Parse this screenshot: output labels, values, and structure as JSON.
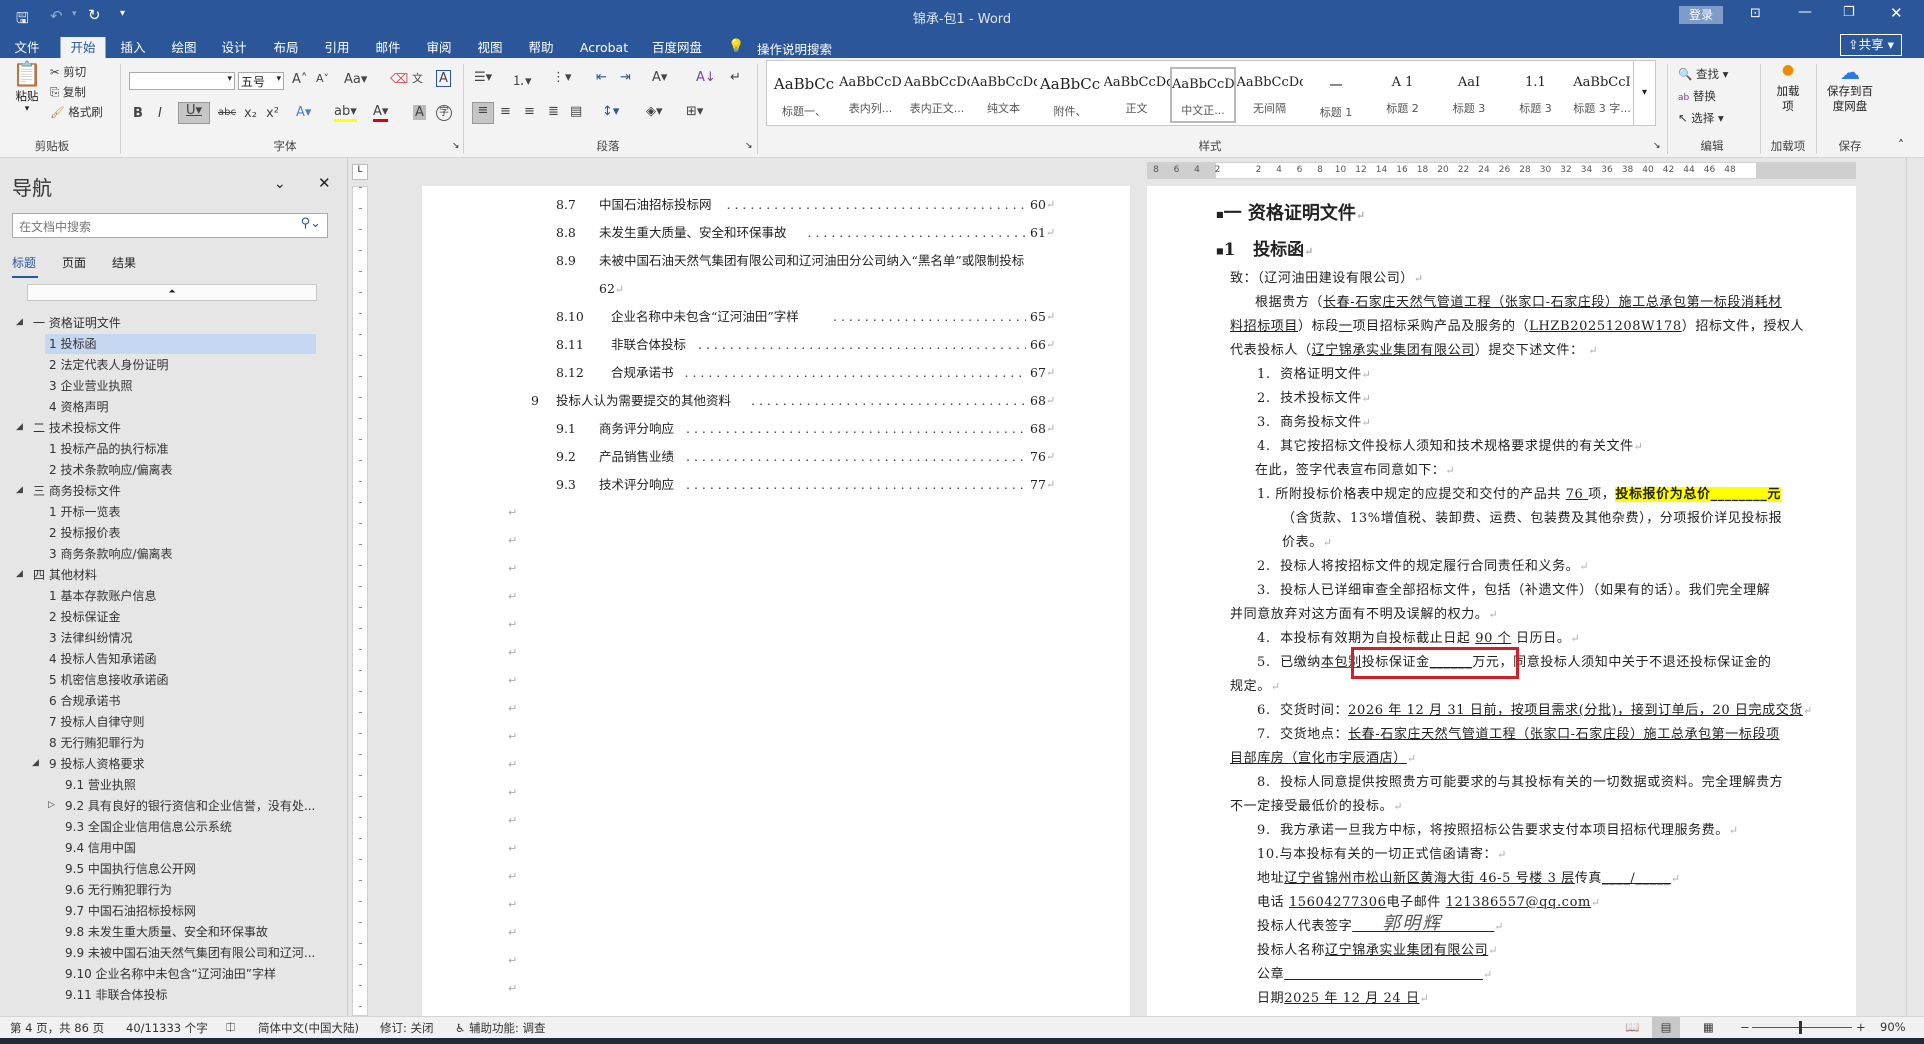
{
  "window": {
    "title": "锦承-包1 - Word",
    "login": "登录"
  },
  "qat": {
    "save": "save-icon",
    "undo": "undo-icon",
    "redo": "redo-icon",
    "customize": "▾"
  },
  "tabs": [
    "文件",
    "开始",
    "插入",
    "绘图",
    "设计",
    "布局",
    "引用",
    "邮件",
    "审阅",
    "视图",
    "帮助",
    "Acrobat",
    "百度网盘"
  ],
  "active_tab": "开始",
  "tell_me": "操作说明搜索",
  "share": "共享",
  "ribbon": {
    "clipboard": {
      "paste": "粘贴",
      "cut": "剪切",
      "copy": "复制",
      "format_painter": "格式刷",
      "label": "剪贴板"
    },
    "font": {
      "font_name": "",
      "font_size": "五号",
      "label": "字体"
    },
    "paragraph": {
      "label": "段落"
    },
    "styles": {
      "label": "样式",
      "items": [
        {
          "preview": "AaBbCc",
          "name": "标题一、"
        },
        {
          "preview": "AaBbCcD",
          "name": "表内列..."
        },
        {
          "preview": "AaBbCcDdI",
          "name": "表内正文..."
        },
        {
          "preview": "AaBbCcDdI",
          "name": "纯文本"
        },
        {
          "preview": "AaBbCc",
          "name": "附件、"
        },
        {
          "preview": "AaBbCcDdI",
          "name": "正文"
        },
        {
          "preview": "AaBbCcDc",
          "name": "中文正..."
        },
        {
          "preview": "AaBbCcDdI",
          "name": "无间隔"
        },
        {
          "preview": "一",
          "name": "标题 1"
        },
        {
          "preview": "A 1",
          "name": "标题 2"
        },
        {
          "preview": "AaI",
          "name": "标题 3"
        },
        {
          "preview": "1.1",
          "name": "标题 3"
        },
        {
          "preview": "AaBbCcI",
          "name": "标题 3 字..."
        }
      ],
      "selected": "中文正..."
    },
    "editing": {
      "find": "查找",
      "replace": "替换",
      "select": "选择",
      "label": "编辑"
    },
    "addins": {
      "button": "加载项",
      "label": "加载项"
    },
    "save_group": {
      "button": "保存到百度网盘",
      "label": "保存"
    }
  },
  "nav": {
    "title": "导航",
    "search_placeholder": "在文档中搜索",
    "tabs": [
      "标题",
      "页面",
      "结果"
    ],
    "active_tab": "标题",
    "items": [
      {
        "level": 1,
        "text": "一 资格证明文件",
        "state": "expanded"
      },
      {
        "level": 2,
        "text": "1 投标函",
        "selected": true
      },
      {
        "level": 2,
        "text": "2 法定代表人身份证明"
      },
      {
        "level": 2,
        "text": "3 企业营业执照"
      },
      {
        "level": 2,
        "text": "4 资格声明"
      },
      {
        "level": 1,
        "text": "二 技术投标文件",
        "state": "expanded"
      },
      {
        "level": 2,
        "text": "1 投标产品的执行标准"
      },
      {
        "level": 2,
        "text": "2 技术条款响应/偏离表"
      },
      {
        "level": 1,
        "text": "三 商务投标文件",
        "state": "expanded"
      },
      {
        "level": 2,
        "text": "1 开标一览表"
      },
      {
        "level": 2,
        "text": "2 投标报价表"
      },
      {
        "level": 2,
        "text": "3 商务条款响应/偏离表"
      },
      {
        "level": 1,
        "text": "四 其他材料",
        "state": "expanded"
      },
      {
        "level": 2,
        "text": "1 基本存款账户信息"
      },
      {
        "level": 2,
        "text": "2 投标保证金"
      },
      {
        "level": 2,
        "text": "3 法律纠纷情况"
      },
      {
        "level": 2,
        "text": "4 投标人告知承诺函"
      },
      {
        "level": 2,
        "text": "5 机密信息接收承诺函"
      },
      {
        "level": 2,
        "text": "6 合规承诺书"
      },
      {
        "level": 2,
        "text": "7 投标人自律守则"
      },
      {
        "level": 2,
        "text": "8 无行贿犯罪行为"
      },
      {
        "level": 2,
        "text": "9 投标人资格要求",
        "state": "expanded"
      },
      {
        "level": 3,
        "text": "9.1 营业执照"
      },
      {
        "level": 3,
        "text": "9.2 具有良好的银行资信和企业信誉，没有处...",
        "state": "collapsed"
      },
      {
        "level": 3,
        "text": "9.3 全国企业信用信息公示系统"
      },
      {
        "level": 3,
        "text": "9.4 信用中国"
      },
      {
        "level": 3,
        "text": "9.5 中国执行信息公开网"
      },
      {
        "level": 3,
        "text": "9.6 无行贿犯罪行为"
      },
      {
        "level": 3,
        "text": "9.7 中国石油招标投标网"
      },
      {
        "level": 3,
        "text": "9.8 未发生重大质量、安全和环保事故"
      },
      {
        "level": 3,
        "text": "9.9 未被中国石油天然气集团有限公司和辽河..."
      },
      {
        "level": 3,
        "text": "9.10 企业名称中未包含“辽河油田”字样"
      },
      {
        "level": 3,
        "text": "9.11 非联合体投标"
      }
    ]
  },
  "ruler": [
    "8",
    "6",
    "4",
    "2",
    "",
    "2",
    "4",
    "6",
    "8",
    "10",
    "12",
    "14",
    "16",
    "18",
    "20",
    "22",
    "24",
    "26",
    "28",
    "30",
    "32",
    "34",
    "36",
    "38",
    "40",
    "42",
    "44",
    "46",
    "48"
  ],
  "toc": [
    {
      "num": "8.7",
      "title": "中国石油招标投标网",
      "page": "60",
      "level": 2
    },
    {
      "num": "8.8",
      "title": "未发生重大质量、安全和环保事故",
      "page": "61",
      "level": 2
    },
    {
      "num": "8.9",
      "title": "未被中国石油天然气集团有限公司和辽河油田分公司纳入“黑名单”或限制投标",
      "page": "62",
      "level": 2,
      "wrapped": true
    },
    {
      "num": "8.10",
      "title": "企业名称中未包含“辽河油田”字样",
      "page": "65",
      "level": 3
    },
    {
      "num": "8.11",
      "title": "非联合体投标",
      "page": "66",
      "level": 3
    },
    {
      "num": "8.12",
      "title": "合规承诺书",
      "page": "67",
      "level": 3
    },
    {
      "num": "9",
      "title": "投标人认为需要提交的其他资料",
      "page": "68",
      "level": 1
    },
    {
      "num": "9.1",
      "title": "商务评分响应",
      "page": "68",
      "level": 2
    },
    {
      "num": "9.2",
      "title": "产品销售业绩",
      "page": "76",
      "level": 2
    },
    {
      "num": "9.3",
      "title": "技术评分响应",
      "page": "77",
      "level": 2
    }
  ],
  "doc": {
    "heading1": "一 资格证明文件",
    "heading2_num": "1",
    "heading2": "投标函",
    "signature": "郭明辉",
    "lines": [
      {
        "kind": "flush",
        "segs": [
          {
            "t": "致：（辽河油田建设有限公司）"
          }
        ]
      },
      {
        "kind": "first",
        "segs": [
          {
            "t": "根据贵方（"
          },
          {
            "t": "长春-石家庄天然气管道工程（张家口-石家庄段）施工总承包第一标段消耗材",
            "s": "u"
          }
        ],
        "nopm": true
      },
      {
        "kind": "flush",
        "segs": [
          {
            "t": "料招标项目",
            "s": "u"
          },
          {
            "t": "）标段"
          },
          {
            "t": "一",
            "s": "u"
          },
          {
            "t": "项目招标采购产品及服务的（"
          },
          {
            "t": "LHZB20251208W178",
            "s": "u"
          },
          {
            "t": "）招标文件，授权人"
          }
        ],
        "nopm": true
      },
      {
        "kind": "flush",
        "segs": [
          {
            "t": "代表投标人（"
          },
          {
            "t": "辽宁锦承实业集团有限公司",
            "s": "u"
          },
          {
            "t": "）提交下述文件： "
          }
        ]
      },
      {
        "kind": "list",
        "segs": [
          {
            "t": "1.  资格证明文件"
          }
        ]
      },
      {
        "kind": "list",
        "segs": [
          {
            "t": "2.  技术投标文件"
          }
        ]
      },
      {
        "kind": "list",
        "segs": [
          {
            "t": "3.  商务投标文件"
          }
        ]
      },
      {
        "kind": "list",
        "segs": [
          {
            "t": "4.  其它按招标文件投标人须知和技术规格要求提供的有关文件"
          }
        ]
      },
      {
        "kind": "first",
        "segs": [
          {
            "t": "在此，签字代表宣布同意如下："
          }
        ]
      },
      {
        "kind": "list",
        "segs": [
          {
            "t": "1. 所附投标价格表中规定的应提交和交付的产品共 "
          },
          {
            "t": "76 ",
            "s": "u"
          },
          {
            "t": "项，"
          },
          {
            "t": "投标报价为总价________元",
            "s": "hl"
          }
        ],
        "nopm": true
      },
      {
        "kind": "hang",
        "segs": [
          {
            "t": "（含货款、13%增值税、装卸费、运费、包装费及其他杂费），分项报价详见投标报"
          }
        ],
        "nopm": true
      },
      {
        "kind": "hang",
        "segs": [
          {
            "t": "价表。"
          }
        ]
      },
      {
        "kind": "list",
        "segs": [
          {
            "t": "2.  投标人将按招标文件的规定履行合同责任和义务。"
          }
        ]
      },
      {
        "kind": "list",
        "segs": [
          {
            "t": "3.  投标人已详细审查全部招标文件，包括（补遗文件）（如果有的话）。我们完全理解"
          }
        ],
        "nopm": true
      },
      {
        "kind": "flush",
        "segs": [
          {
            "t": "并同意放弃对这方面有不明及误解的权力。"
          }
        ]
      },
      {
        "kind": "list",
        "segs": [
          {
            "t": "4.  本投标有效期为自投标截止日起 "
          },
          {
            "t": "90 个",
            "s": "u"
          },
          {
            "t": " 日历日。"
          }
        ]
      },
      {
        "kind": "list",
        "segs": [
          {
            "t": "5.  已缴纳"
          },
          {
            "t": "本包别",
            "s": "ub"
          },
          {
            "t": "投标保证金"
          },
          {
            "t": "______",
            "s": "u"
          },
          {
            "t": "万元，同意投标人须知中关于不退还投标保证金的"
          }
        ],
        "nopm": true
      },
      {
        "kind": "flush",
        "segs": [
          {
            "t": "规定。"
          }
        ]
      },
      {
        "kind": "list",
        "segs": [
          {
            "t": "6.  交货时间："
          },
          {
            "t": "2026 年 12 月 31 日前，按项目需求(分批)，接到订单后，20 日完成交货",
            "s": "u"
          }
        ]
      },
      {
        "kind": "list",
        "segs": [
          {
            "t": "7.  交货地点："
          },
          {
            "t": "长春-石家庄天然气管道工程（张家口-石家庄段）施工总承包第一标段项",
            "s": "u"
          }
        ],
        "nopm": true
      },
      {
        "kind": "flush",
        "segs": [
          {
            "t": "目部库房（宣化市宇辰酒店）",
            "s": "u"
          }
        ]
      },
      {
        "kind": "list",
        "segs": [
          {
            "t": "8.  投标人同意提供按照贵方可能要求的与其投标有关的一切数据或资料。完全理解贵方"
          }
        ],
        "nopm": true
      },
      {
        "kind": "flush",
        "segs": [
          {
            "t": "不一定接受最低价的投标。"
          }
        ]
      },
      {
        "kind": "list",
        "segs": [
          {
            "t": "9.  我方承诺一旦我方中标，将按照招标公告要求支付本项目招标代理服务费。"
          }
        ]
      },
      {
        "kind": "list",
        "segs": [
          {
            "t": "10.与本投标有关的一切正式信函请寄："
          }
        ]
      },
      {
        "kind": "list",
        "segs": [
          {
            "t": "地址"
          },
          {
            "t": "辽宁省锦州市松山新区黄海大街 46-5 号楼 3 层",
            "s": "u"
          },
          {
            "t": "传真"
          },
          {
            "t": "____/_____",
            "s": "u"
          }
        ]
      },
      {
        "kind": "list",
        "segs": [
          {
            "t": "电话 "
          },
          {
            "t": "15604277306",
            "s": "u"
          },
          {
            "t": "电子邮件 "
          },
          {
            "t": "121386557@qq.com",
            "s": "u"
          }
        ]
      },
      {
        "kind": "list",
        "segs": [
          {
            "t": "投标人代表签字"
          },
          {
            "t": "                              ",
            "s": "u",
            "sig": true
          }
        ]
      },
      {
        "kind": "list",
        "segs": [
          {
            "t": "投标人名称"
          },
          {
            "t": "辽宁锦承实业集团有限公司",
            "s": "u"
          }
        ]
      },
      {
        "kind": "list",
        "segs": [
          {
            "t": "公章"
          },
          {
            "t": "                                          ",
            "s": "u"
          }
        ]
      },
      {
        "kind": "list",
        "segs": [
          {
            "t": "日期"
          },
          {
            "t": "2025 年 12 月 24 日",
            "s": "u"
          }
        ]
      }
    ]
  },
  "status": {
    "page": "第 4 页，共 86 页",
    "words": "40/11333 个字",
    "language": "简体中文(中国大陆)",
    "track_changes": "修订: 关闭",
    "accessibility": "辅助功能: 调查",
    "zoom": "90%",
    "zoom_level": 90
  },
  "colors": {
    "brand": "#2b579a",
    "highlight": "#ffff00",
    "annotation_box": "#d0202a",
    "nav_selected": "#c5d7f1"
  }
}
